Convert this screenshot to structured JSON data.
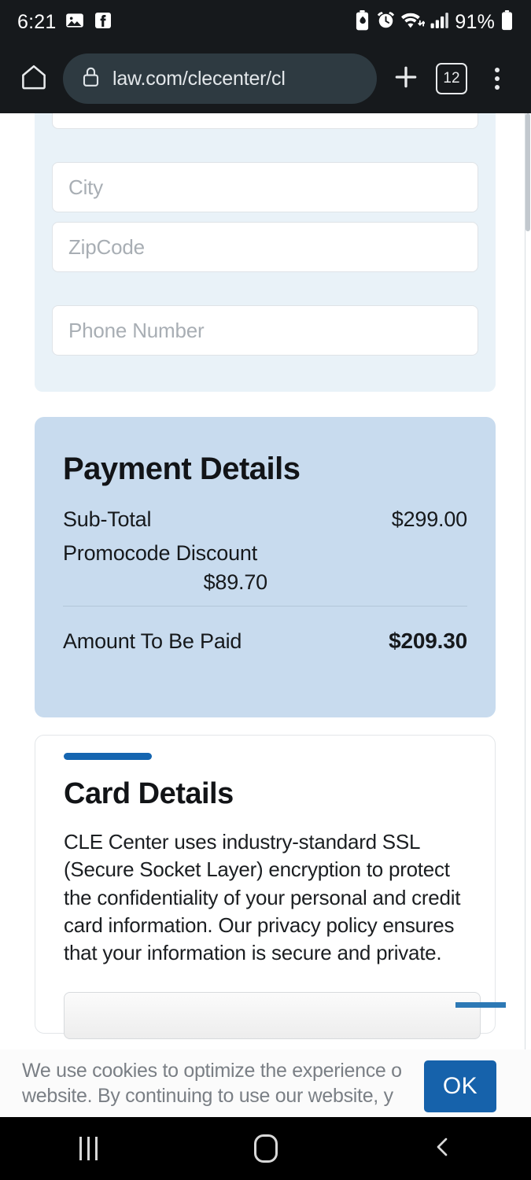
{
  "status_bar": {
    "clock": "6:21",
    "battery_percent": "91%",
    "left_icons": [
      "photos-icon",
      "facebook-icon"
    ],
    "right_icons": [
      "battery-saver-icon",
      "alarm-clock-icon",
      "wifi-icon",
      "signal-bars-icon",
      "battery-icon"
    ]
  },
  "browser": {
    "home_icon": "home-icon",
    "lock_icon": "lock-icon",
    "url": "law.com/clecenter/cl",
    "new_tab_label": "+",
    "tab_count": "12",
    "menu_icon": "overflow-menu-icon"
  },
  "address_form": {
    "fields": [
      {
        "placeholder": "",
        "name": "address-field-partial"
      },
      {
        "placeholder": "City",
        "name": "city-field"
      },
      {
        "placeholder": "ZipCode",
        "name": "zipcode-field"
      },
      {
        "placeholder": "Phone Number",
        "name": "phone-field"
      }
    ]
  },
  "payment_details": {
    "title": "Payment Details",
    "subtotal_label": "Sub-Total",
    "subtotal_value": "$299.00",
    "discount_label": "Promocode Discount",
    "discount_value": "$89.70",
    "total_label": "Amount To Be Paid",
    "total_value": "$209.30"
  },
  "card_details": {
    "title": "Card Details",
    "body": "CLE Center uses industry-standard SSL (Secure Socket Layer) encryption to protect the confidentiality of your personal and credit card information. Our privacy policy ensures that your information is secure and private.",
    "accent_color": "#1565b0"
  },
  "cookie_banner": {
    "text": "We use cookies to optimize the experience o website. By continuing to use our website, y",
    "ok_label": "OK",
    "ok_color": "#1662ab"
  },
  "android_nav": {
    "recents_label": "recents-icon",
    "home_label": "home-icon",
    "back_label": "back-icon"
  }
}
